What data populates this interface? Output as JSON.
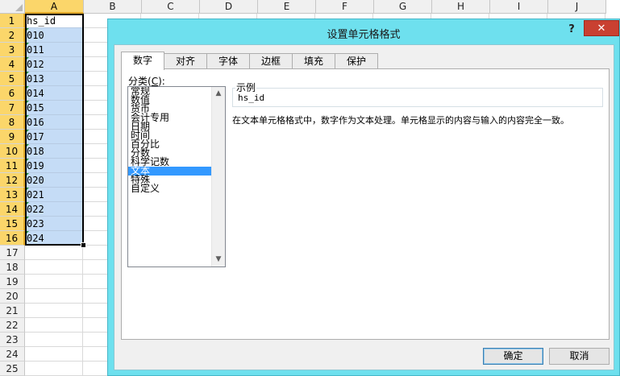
{
  "sheet": {
    "columns": [
      "A",
      "B",
      "C",
      "D",
      "E",
      "F",
      "G",
      "H",
      "I",
      "J"
    ],
    "rows": [
      "1",
      "2",
      "3",
      "4",
      "5",
      "6",
      "7",
      "8",
      "9",
      "10",
      "11",
      "12",
      "13",
      "14",
      "15",
      "16",
      "17",
      "18",
      "19",
      "20",
      "21",
      "22",
      "23",
      "24",
      "25"
    ],
    "colA": [
      "hs_id",
      "010",
      "011",
      "012",
      "013",
      "014",
      "015",
      "016",
      "017",
      "018",
      "019",
      "020",
      "021",
      "022",
      "023",
      "024"
    ]
  },
  "dialog": {
    "title": "设置单元格格式",
    "help_glyph": "?",
    "close_glyph": "✕",
    "tabs": [
      "数字",
      "对齐",
      "字体",
      "边框",
      "填充",
      "保护"
    ],
    "category_label_prefix": "分类(",
    "category_label_key": "C",
    "category_label_suffix": "):",
    "categories": [
      "常规",
      "数值",
      "货币",
      "会计专用",
      "日期",
      "时间",
      "百分比",
      "分数",
      "科学记数",
      "文本",
      "特殊",
      "自定义"
    ],
    "selected_category": "文本",
    "sample_label": "示例",
    "sample_value": "hs_id",
    "description": "在文本单元格格式中，数字作为文本处理。单元格显示的内容与输入的内容完全一致。",
    "ok_label": "确定",
    "cancel_label": "取消"
  },
  "colors": {
    "dialog_frame": "#6ee0ee",
    "selection": "#c5dcf6",
    "header_selected": "#fbd66a",
    "list_selected": "#3399ff",
    "close_button": "#c94031"
  }
}
